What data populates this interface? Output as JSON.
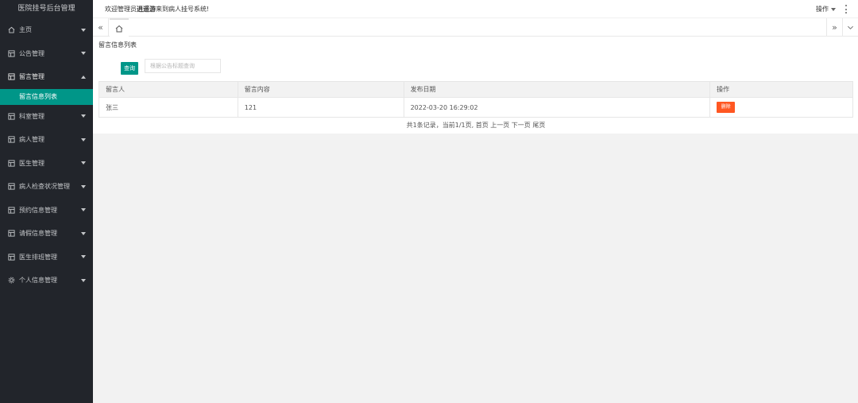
{
  "sidebar": {
    "logo": "医院挂号后台管理",
    "items": [
      {
        "label": "主页",
        "icon": "home-icon",
        "expanded": false
      },
      {
        "label": "公告管理",
        "icon": "grid-icon",
        "expanded": false
      },
      {
        "label": "留言管理",
        "icon": "grid-icon",
        "expanded": true,
        "children": [
          "留言信息列表"
        ]
      },
      {
        "label": "科室管理",
        "icon": "grid-icon",
        "expanded": false
      },
      {
        "label": "病人管理",
        "icon": "grid-icon",
        "expanded": false
      },
      {
        "label": "医生管理",
        "icon": "grid-icon",
        "expanded": false
      },
      {
        "label": "病人检查状况管理",
        "icon": "grid-icon",
        "expanded": false
      },
      {
        "label": "预约信息管理",
        "icon": "grid-icon",
        "expanded": false
      },
      {
        "label": "请假信息管理",
        "icon": "grid-icon",
        "expanded": false
      },
      {
        "label": "医生排班管理",
        "icon": "grid-icon",
        "expanded": false
      },
      {
        "label": "个人信息管理",
        "icon": "gear-icon",
        "expanded": false
      }
    ]
  },
  "header": {
    "welcome_prefix": "欢迎管理员",
    "welcome_user": "逍遥游",
    "welcome_suffix": "来到病人挂号系统!",
    "ops_label": "操作"
  },
  "tabs": {
    "home_icon": "home-icon"
  },
  "main": {
    "title": "留言信息列表",
    "search_button": "查询",
    "search_placeholder": "根据公告标题查询",
    "table": {
      "headers": [
        "留言人",
        "留言内容",
        "发布日期",
        "操作"
      ],
      "rows": [
        {
          "author": "张三",
          "content": "121",
          "date": "2022-03-20 16:29:02",
          "action": "删除"
        }
      ]
    },
    "pager": {
      "summary": "共1条记录，当前1/1页,",
      "first": "首页",
      "prev": "上一页",
      "next": "下一页",
      "last": "尾页"
    }
  },
  "colors": {
    "sidebar_bg": "#22252b",
    "accent": "#009688",
    "danger": "#ff5722"
  }
}
